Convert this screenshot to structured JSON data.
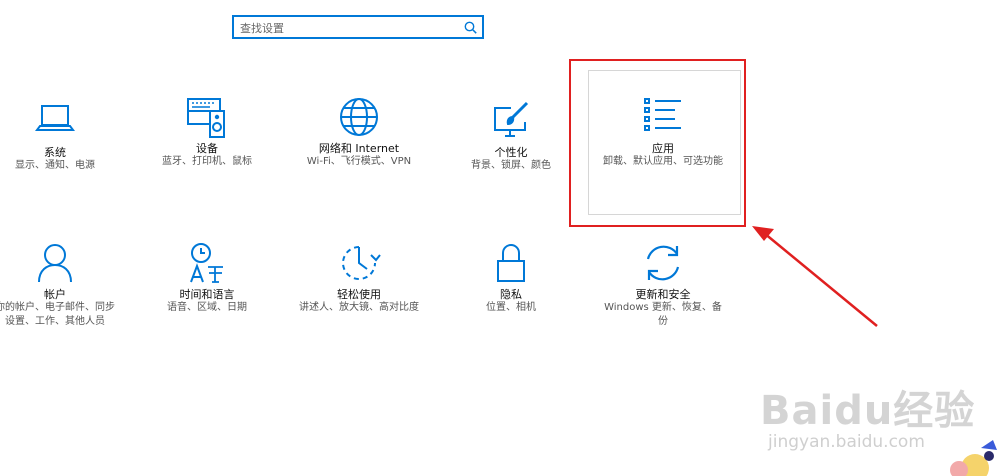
{
  "search": {
    "placeholder": "查找设置"
  },
  "tiles": [
    {
      "title": "系统",
      "desc": "显示、通知、电源",
      "icon": "laptop-icon"
    },
    {
      "title": "设备",
      "desc": "蓝牙、打印机、鼠标",
      "icon": "keyboard-speaker-icon"
    },
    {
      "title": "网络和 Internet",
      "desc": "Wi-Fi、飞行模式、VPN",
      "icon": "globe-icon"
    },
    {
      "title": "个性化",
      "desc": "背景、锁屏、颜色",
      "icon": "paint-screen-icon"
    },
    {
      "title": "应用",
      "desc": "卸载、默认应用、可选功能",
      "icon": "apps-list-icon"
    },
    {
      "title": "帐户",
      "desc_line1": "你的帐户、电子邮件、同步",
      "desc_line2": "设置、工作、其他人员",
      "icon": "person-icon"
    },
    {
      "title": "时间和语言",
      "desc": "语音、区域、日期",
      "icon": "time-language-icon"
    },
    {
      "title": "轻松使用",
      "desc": "讲述人、放大镜、高对比度",
      "icon": "ease-of-access-icon"
    },
    {
      "title": "隐私",
      "desc": "位置、相机",
      "icon": "lock-icon"
    },
    {
      "title": "更新和安全",
      "desc_line1": "Windows 更新、恢复、备",
      "desc_line2": "份",
      "icon": "sync-icon"
    }
  ],
  "colors": {
    "accent": "#0078d7",
    "highlight": "#e02020"
  },
  "watermark": {
    "logo": "Baidu经验",
    "sub": "jingyan.baidu.com"
  }
}
